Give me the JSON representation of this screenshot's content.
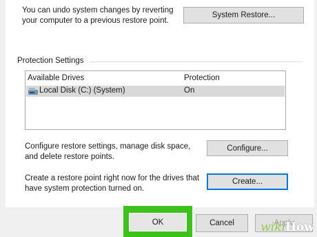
{
  "restore": {
    "description_line1": "You can undo system changes by reverting",
    "description_line2": "your computer to a previous restore point.",
    "button_label": "System Restore..."
  },
  "protection": {
    "group_title": "Protection Settings",
    "columns": [
      "Available Drives",
      "Protection"
    ],
    "drives": [
      {
        "name": "Local Disk (C:) (System)",
        "protection": "On",
        "icon": "drive-icon"
      }
    ]
  },
  "configure": {
    "line1": "Configure restore settings, manage disk space,",
    "line2": "and delete restore points.",
    "button_label": "Configure..."
  },
  "create": {
    "line1": "Create a restore point right now for the drives that",
    "line2": "have system protection turned on.",
    "button_label": "Create..."
  },
  "footer": {
    "ok_label": "OK",
    "cancel_label": "Cancel",
    "apply_label": "Apply"
  },
  "watermark": {
    "wiki": "wiki",
    "how": "How"
  }
}
